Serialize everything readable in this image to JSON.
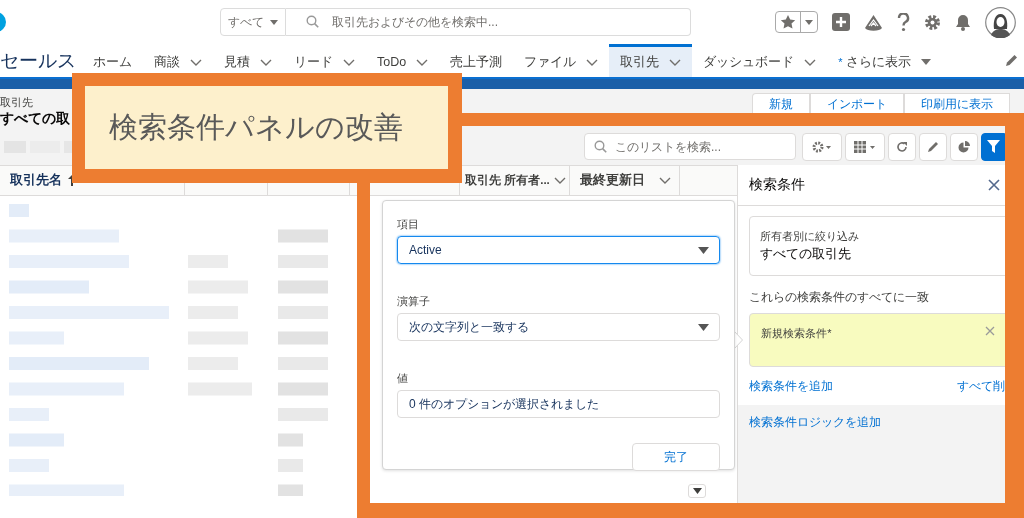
{
  "global_header": {
    "scope_label": "すべて",
    "search_placeholder": "取引先およびその他を検索中..."
  },
  "app_name": "セールス",
  "nav_items": [
    {
      "kind": "tab",
      "label": "ホーム",
      "selected": false,
      "menu": false
    },
    {
      "kind": "tab",
      "label": "商談",
      "selected": false,
      "menu": true
    },
    {
      "kind": "tab",
      "label": "見積",
      "selected": false,
      "menu": true
    },
    {
      "kind": "tab",
      "label": "リード",
      "selected": false,
      "menu": true
    },
    {
      "kind": "tab",
      "label": "ToDo",
      "selected": false,
      "menu": true
    },
    {
      "kind": "tab",
      "label": "売上予測",
      "selected": false,
      "menu": false
    },
    {
      "kind": "tab",
      "label": "ファイル",
      "selected": false,
      "menu": true
    },
    {
      "kind": "tab",
      "label": "取引先",
      "selected": true,
      "menu": true
    },
    {
      "kind": "tab",
      "label": "ダッシュボード",
      "selected": false,
      "menu": true
    },
    {
      "kind": "more",
      "label": "さらに表示",
      "marker": "*",
      "selected": false,
      "menu": true
    }
  ],
  "page_header": {
    "object_label": "取引先",
    "title": "すべての取",
    "buttons": [
      "新規",
      "インポート",
      "印刷用に表示"
    ]
  },
  "list_search": {
    "placeholder": "このリストを検索..."
  },
  "table": {
    "columns": [
      {
        "label": "取引先名",
        "sorted": true
      },
      {
        "label": "取引先 所有者...",
        "sorted": false
      },
      {
        "label": "最終更新日",
        "sorted": false
      }
    ]
  },
  "filter_editor": {
    "fields": [
      {
        "kind": "select",
        "label": "項目",
        "value": "Active",
        "focused": true
      },
      {
        "kind": "select",
        "label": "演算子",
        "value": "次の文字列と一致する",
        "focused": false
      },
      {
        "kind": "text",
        "label": "値",
        "value": "0 件のオプションが選択されました",
        "focused": false
      }
    ],
    "done_button": "完了"
  },
  "filter_panel": {
    "title": "検索条件",
    "scope": {
      "label": "所有者別に絞り込み",
      "value": "すべての取引先"
    },
    "match_label": "これらの検索条件のすべてに一致",
    "filters": [
      {
        "label": "新規検索条件*",
        "selected": true
      }
    ],
    "add_link": "検索条件を追加",
    "remove_all_link": "すべて削",
    "logic_link": "検索条件ロジックを追加"
  },
  "annotation": {
    "text": "検索条件パネルの改善"
  }
}
